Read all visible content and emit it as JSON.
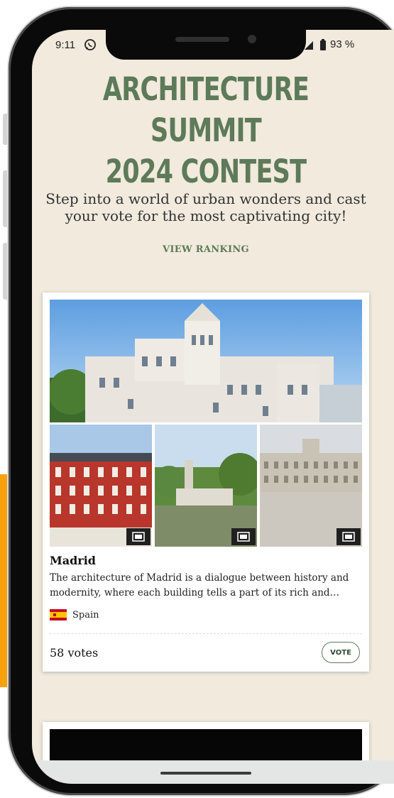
{
  "status_bar": {
    "time": "9:11",
    "battery": "93 %"
  },
  "headline": {
    "line1": "ARCHITECTURE SUMMIT",
    "line2": "2024 CONTEST"
  },
  "subhead": "Step into a world of urban wonders and cast your vote for the most captivating city!",
  "view_ranking_label": "VIEW RANKING",
  "card": {
    "city": "Madrid",
    "description": "The architecture of Madrid is a dialogue between history and modernity, where each building tells a part of its rich and…",
    "country": "Spain",
    "votes": "58 votes",
    "vote_label": "VOTE"
  },
  "colors": {
    "accent_green": "#5d7a59",
    "page_bg": "#f1eadd",
    "orange_accent": "#f7a20c"
  }
}
